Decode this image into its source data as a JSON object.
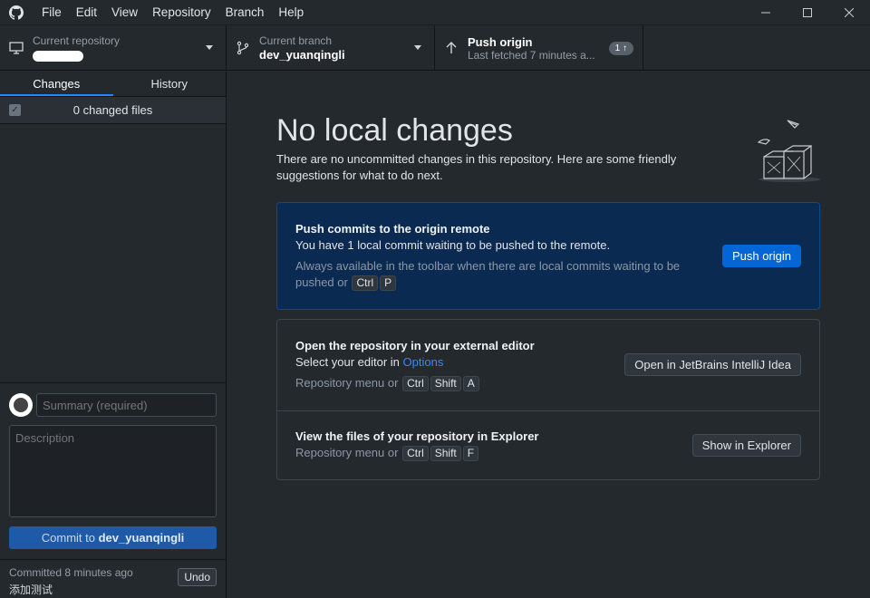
{
  "menu": [
    "File",
    "Edit",
    "View",
    "Repository",
    "Branch",
    "Help"
  ],
  "toolbar": {
    "repo_label": "Current repository",
    "branch_label": "Current branch",
    "branch_value": "dev_yuanqingli",
    "push_label": "Push origin",
    "push_sub": "Last fetched 7 minutes a...",
    "push_badge": "1 ↑"
  },
  "sidebar": {
    "tabs": [
      "Changes",
      "History"
    ],
    "active_tab": "Changes",
    "changed_files": "0 changed files",
    "summary_placeholder": "Summary (required)",
    "description_placeholder": "Description",
    "commit_button_prefix": "Commit to",
    "commit_button_branch": "dev_yuanqingli",
    "last_commit_time": "Committed 8 minutes ago",
    "last_commit_message": "添加测试",
    "undo_label": "Undo"
  },
  "main": {
    "heading": "No local changes",
    "subtext": "There are no uncommitted changes in this repository. Here are some friendly suggestions for what to do next.",
    "push_card": {
      "title": "Push commits to the origin remote",
      "text": "You have 1 local commit waiting to be pushed to the remote.",
      "muted_prefix": "Always available in the toolbar when there are local commits waiting to be pushed or",
      "keys": [
        "Ctrl",
        "P"
      ],
      "button": "Push origin"
    },
    "editor_card": {
      "title": "Open the repository in your external editor",
      "text_prefix": "Select your editor in",
      "link": "Options",
      "muted_prefix": "Repository menu or",
      "keys": [
        "Ctrl",
        "Shift",
        "A"
      ],
      "button": "Open in JetBrains IntelliJ Idea"
    },
    "explorer_card": {
      "title": "View the files of your repository in Explorer",
      "muted_prefix": "Repository menu or",
      "keys": [
        "Ctrl",
        "Shift",
        "F"
      ],
      "button": "Show in Explorer"
    }
  },
  "colors": {
    "background": "#24292e",
    "accent": "#0366d6",
    "push_card_bg": "#0b2a52",
    "commit_button": "#1e5aa8"
  }
}
